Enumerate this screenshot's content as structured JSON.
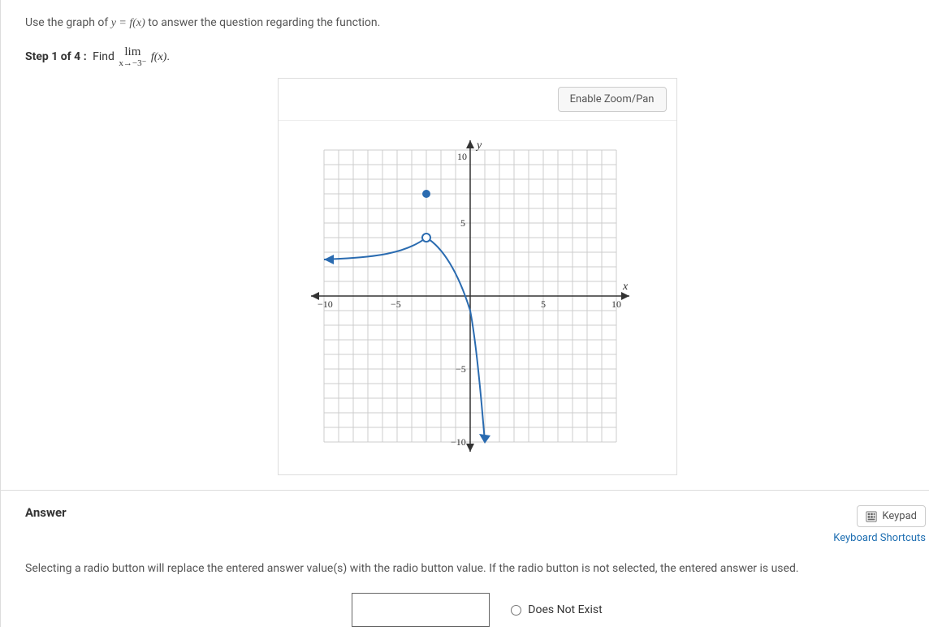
{
  "question": {
    "intro_prefix": "Use the graph of ",
    "intro_eq": "y = f(x)",
    "intro_suffix": " to answer the question regarding the function."
  },
  "step": {
    "label": "Step 1 of 4 :",
    "find": "Find",
    "lim_top": "lim",
    "lim_bot": "x→−3⁻",
    "fx": "f(x)",
    "period": "."
  },
  "chart": {
    "zoom_label": "Enable Zoom/Pan",
    "x_label": "x",
    "y_label": "y",
    "ticks": {
      "neg10": "−10",
      "neg5": "−5",
      "pos5": "5",
      "pos10": "10"
    }
  },
  "answer": {
    "heading": "Answer",
    "keypad": "Keypad",
    "shortcuts": "Keyboard Shortcuts",
    "helper": "Selecting a radio button will replace the entered answer value(s) with the radio button value. If the radio button is not selected, the entered answer is used.",
    "input_value": "",
    "dne_label": "Does Not Exist"
  },
  "chart_data": {
    "type": "line",
    "xlim": [
      -11,
      11
    ],
    "ylim": [
      -11,
      11
    ],
    "xlabel": "x",
    "ylabel": "y",
    "series": [
      {
        "name": "left-branch",
        "points": [
          [
            -11,
            2.5
          ],
          [
            -10,
            2.5
          ],
          [
            -8,
            2.6
          ],
          [
            -6,
            2.8
          ],
          [
            -4,
            3.2
          ],
          [
            -3,
            4
          ]
        ],
        "end_open_circle": [
          -3,
          4
        ]
      },
      {
        "name": "right-branch",
        "points": [
          [
            -3,
            4
          ],
          [
            -2,
            3.2
          ],
          [
            -1,
            1.5
          ],
          [
            0,
            -1
          ],
          [
            0.5,
            -4
          ],
          [
            1,
            -10
          ]
        ],
        "start_open_circle": [
          -3,
          4
        ]
      }
    ],
    "open_point": [
      -3,
      4
    ],
    "filled_point": [
      -3,
      7
    ]
  }
}
